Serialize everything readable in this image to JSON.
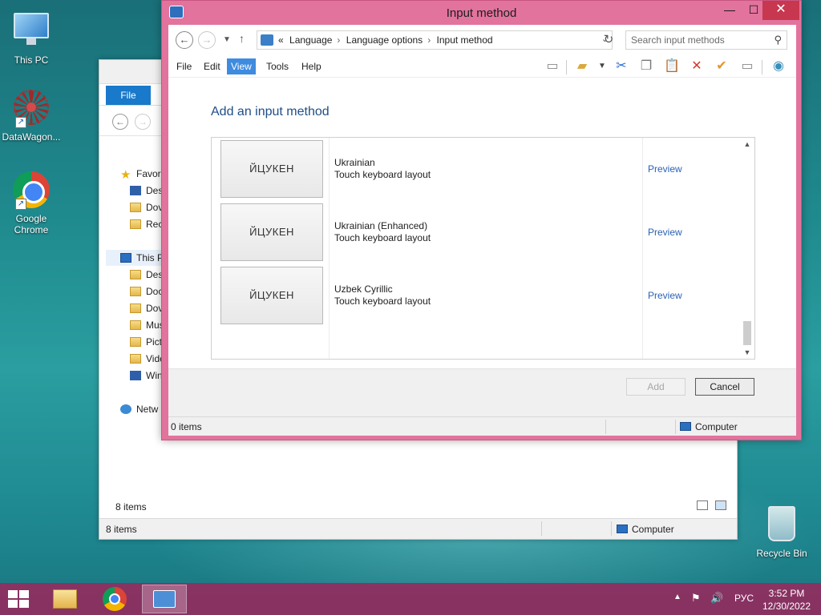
{
  "desktop": {
    "icons": [
      {
        "label": "This PC",
        "icon": "computer-icon"
      },
      {
        "label": "DataWagon...",
        "icon": "datawagon-icon"
      },
      {
        "label": "Google Chrome",
        "icon": "chrome-icon"
      },
      {
        "label": "Recycle Bin",
        "icon": "recycle-bin-icon"
      }
    ]
  },
  "background_explorer": {
    "file_tab": "File",
    "tree": [
      {
        "label": "Favor",
        "icon": "star-icon"
      },
      {
        "label": "Des",
        "icon": "desktop-icon"
      },
      {
        "label": "Dov",
        "icon": "downloads-icon"
      },
      {
        "label": "Rec",
        "icon": "recent-icon"
      },
      {
        "label": "This P",
        "icon": "computer-icon"
      },
      {
        "label": "Des",
        "icon": "folder-icon"
      },
      {
        "label": "Doc",
        "icon": "folder-icon"
      },
      {
        "label": "Dov",
        "icon": "folder-icon"
      },
      {
        "label": "Mus",
        "icon": "folder-icon"
      },
      {
        "label": "Pict",
        "icon": "folder-icon"
      },
      {
        "label": "Vide",
        "icon": "folder-icon"
      },
      {
        "label": "Win",
        "icon": "drive-icon"
      },
      {
        "label": "Netw",
        "icon": "network-icon"
      }
    ],
    "items_count": "8 items",
    "status_items": "8 items",
    "status_location": "Computer"
  },
  "window": {
    "title": "Input method",
    "breadcrumb": {
      "prefix": "«",
      "items": [
        "Language",
        "Language options",
        "Input method"
      ]
    },
    "search_placeholder": "Search input methods",
    "menu": {
      "file": "File",
      "edit": "Edit",
      "view": "View",
      "tools": "Tools",
      "help": "Help"
    },
    "heading": "Add an input method",
    "rows": [
      {
        "preview_text": "ЙЦУКЕН",
        "name": "Ukrainian",
        "subtitle": "Touch keyboard layout",
        "link": "Preview"
      },
      {
        "preview_text": "ЙЦУКЕН",
        "name": "Ukrainian (Enhanced)",
        "subtitle": "Touch keyboard layout",
        "link": "Preview"
      },
      {
        "preview_text": "ЙЦУКЕН",
        "name": "Uzbek Cyrillic",
        "subtitle": "Touch keyboard layout",
        "link": "Preview"
      }
    ],
    "buttons": {
      "add": "Add",
      "cancel": "Cancel"
    },
    "status": {
      "items": "0 items",
      "location": "Computer"
    }
  },
  "taskbar": {
    "language": "РУС",
    "time": "3:52 PM",
    "date": "12/30/2022"
  },
  "colors": {
    "window_frame": "#e2739d",
    "taskbar": "#912d5f",
    "accent_blue": "#3e8be0",
    "link": "#2a62b5",
    "close": "#c7374f"
  }
}
